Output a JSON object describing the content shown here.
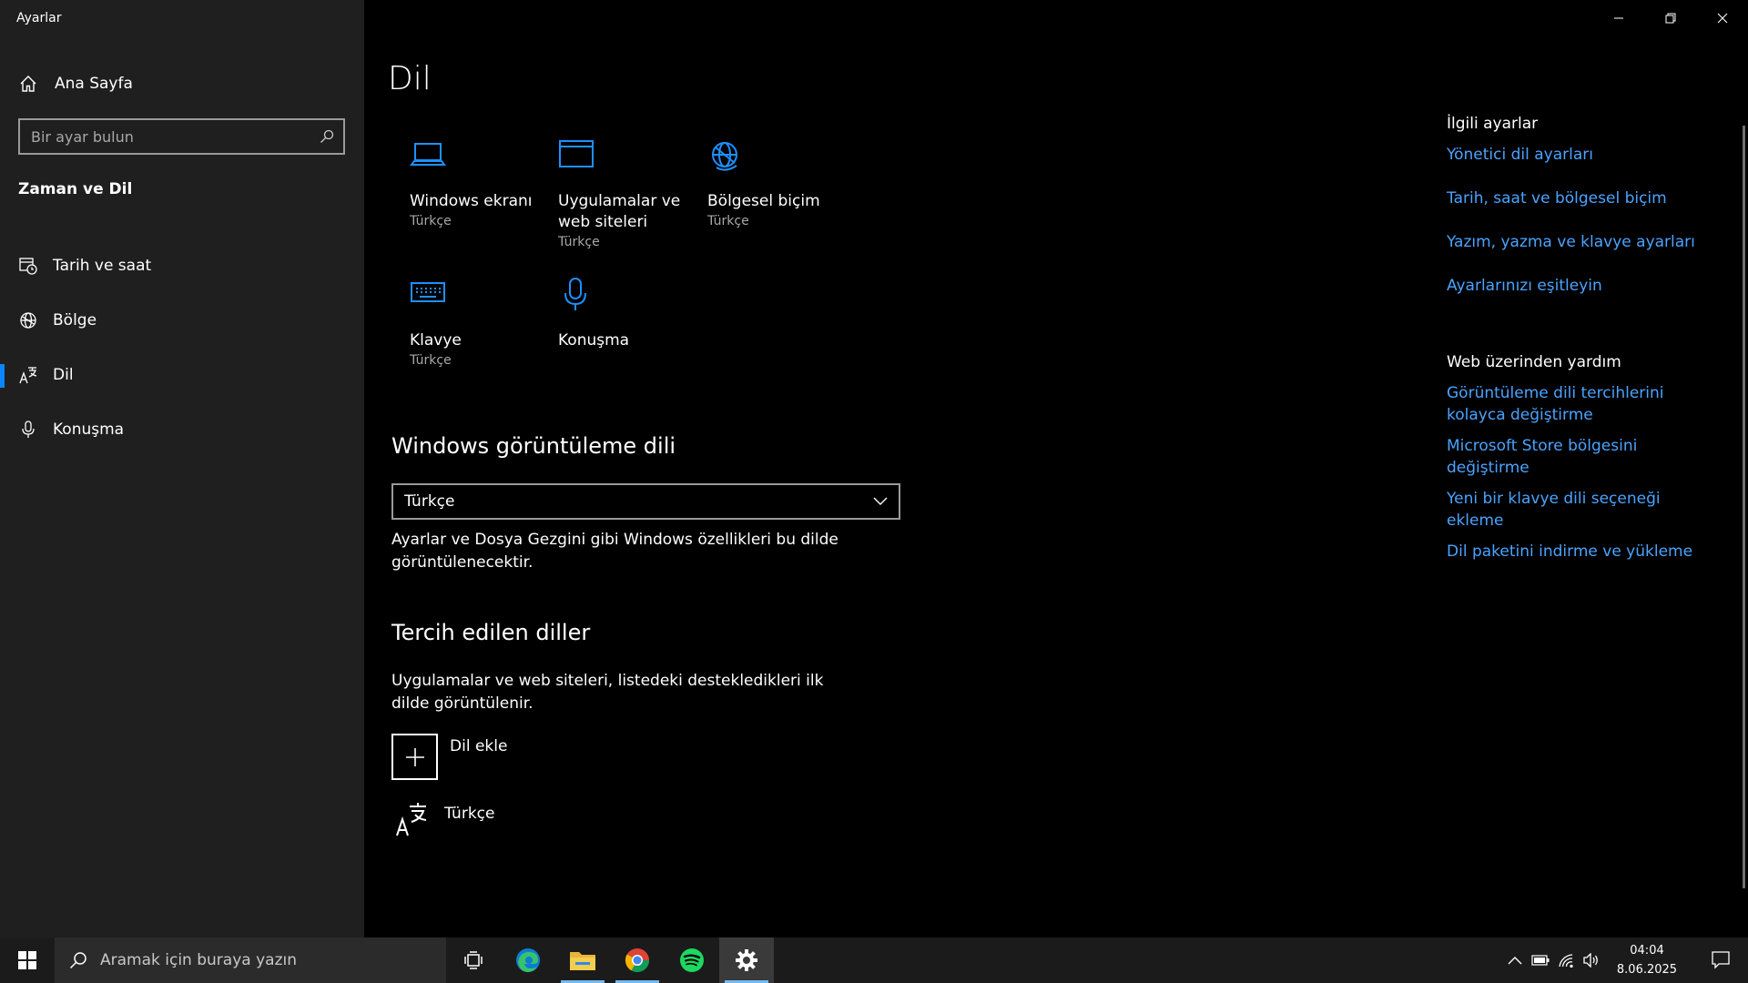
{
  "window": {
    "title": "Ayarlar"
  },
  "sidebar": {
    "home_label": "Ana Sayfa",
    "search_placeholder": "Bir ayar bulun",
    "section_title": "Zaman ve Dil",
    "items": [
      {
        "label": "Tarih ve saat",
        "icon": "calendar-clock-icon",
        "active": false
      },
      {
        "label": "Bölge",
        "icon": "globe-icon",
        "active": false
      },
      {
        "label": "Dil",
        "icon": "language-icon",
        "active": true
      },
      {
        "label": "Konuşma",
        "icon": "microphone-icon",
        "active": false
      }
    ]
  },
  "main": {
    "title": "Dil",
    "tiles": [
      {
        "label": "Windows ekranı",
        "sub": "Türkçe",
        "icon": "laptop-icon"
      },
      {
        "label": "Uygulamalar ve web siteleri",
        "sub": "Türkçe",
        "icon": "app-window-icon"
      },
      {
        "label": "Bölgesel biçim",
        "sub": "Türkçe",
        "icon": "globe-icon"
      },
      {
        "label": "Klavye",
        "sub": "Türkçe",
        "icon": "keyboard-icon"
      },
      {
        "label": "Konuşma",
        "sub": "",
        "icon": "microphone-icon"
      }
    ],
    "display_language": {
      "heading": "Windows görüntüleme dili",
      "selected": "Türkçe",
      "description": "Ayarlar ve Dosya Gezgini gibi Windows özellikleri bu dilde görüntülenecektir."
    },
    "preferred": {
      "heading": "Tercih edilen diller",
      "description": "Uygulamalar ve web siteleri, listedeki destekledikleri ilk dilde görüntülenir.",
      "add_label": "Dil ekle",
      "languages": [
        "Türkçe"
      ]
    }
  },
  "related": {
    "heading": "İlgili ayarlar",
    "links": [
      "Yönetici dil ayarları",
      "Tarih, saat ve bölgesel biçim",
      "Yazım, yazma ve klavye ayarları",
      "Ayarlarınızı eşitleyin"
    ]
  },
  "web_help": {
    "heading": "Web üzerinden yardım",
    "links": [
      "Görüntüleme dili tercihlerini kolayca değiştirme",
      "Microsoft Store bölgesini değiştirme",
      "Yeni bir klavye dili seçeneği ekleme",
      "Dil paketini indirme ve yükleme"
    ]
  },
  "taskbar": {
    "search_placeholder": "Aramak için buraya yazın",
    "apps": [
      "task-view",
      "edge",
      "file-explorer",
      "chrome",
      "spotify",
      "settings"
    ],
    "time": "04:04",
    "date": "8.06.2025"
  },
  "colors": {
    "accent": "#0a84ff",
    "link": "#4aa3ff",
    "icon": "#1e90ff",
    "sidebar_bg": "#1f1f1f"
  }
}
